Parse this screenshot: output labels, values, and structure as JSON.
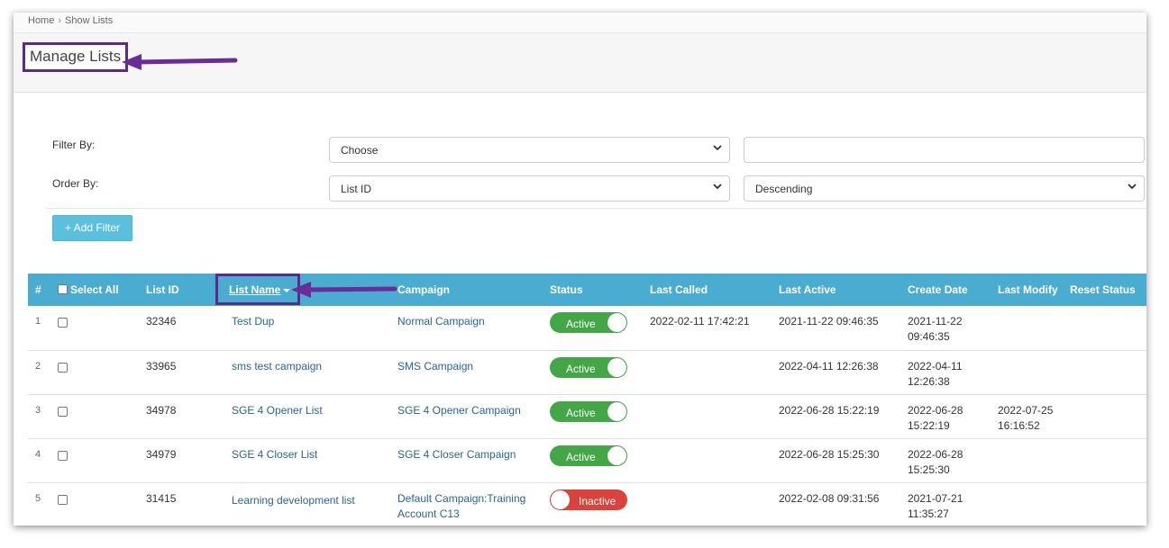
{
  "breadcrumb": {
    "home": "Home",
    "separator": "›",
    "current": "Show Lists"
  },
  "page": {
    "title": "Manage Lists"
  },
  "filters": {
    "filter_by_label": "Filter By:",
    "filter_by_value": "Choose",
    "filter_text_value": "",
    "order_by_label": "Order By:",
    "order_by_value": "List ID",
    "order_direction_value": "Descending",
    "add_filter_label": "+ Add Filter"
  },
  "table": {
    "headers": {
      "num": "#",
      "select_all": "Select All",
      "list_id": "List ID",
      "list_name": "List Name",
      "campaign": "Campaign",
      "status": "Status",
      "last_called": "Last Called",
      "last_active": "Last Active",
      "create_date": "Create Date",
      "last_modify": "Last Modify",
      "reset_status": "Reset Status"
    },
    "rows": [
      {
        "num": "1",
        "list_id": "32346",
        "list_name": "Test Dup",
        "campaign": "Normal Campaign",
        "status": "Active",
        "last_called": "2022-02-11 17:42:21",
        "last_active": "2021-11-22 09:46:35",
        "create_date_1": "2021-11-22",
        "create_date_2": "09:46:35",
        "last_modify_1": "",
        "last_modify_2": ""
      },
      {
        "num": "2",
        "list_id": "33965",
        "list_name": "sms test campaign",
        "campaign": "SMS Campaign",
        "status": "Active",
        "last_called": "",
        "last_active": "2022-04-11 12:26:38",
        "create_date_1": "2022-04-11",
        "create_date_2": "12:26:38",
        "last_modify_1": "",
        "last_modify_2": ""
      },
      {
        "num": "3",
        "list_id": "34978",
        "list_name": "SGE 4 Opener List",
        "campaign": "SGE 4 Opener Campaign",
        "status": "Active",
        "last_called": "",
        "last_active": "2022-06-28 15:22:19",
        "create_date_1": "2022-06-28",
        "create_date_2": "15:22:19",
        "last_modify_1": "2022-07-25",
        "last_modify_2": "16:16:52"
      },
      {
        "num": "4",
        "list_id": "34979",
        "list_name": "SGE 4 Closer List",
        "campaign": "SGE 4 Closer Campaign",
        "status": "Active",
        "last_called": "",
        "last_active": "2022-06-28 15:25:30",
        "create_date_1": "2022-06-28",
        "create_date_2": "15:25:30",
        "last_modify_1": "",
        "last_modify_2": ""
      },
      {
        "num": "5",
        "list_id": "31415",
        "list_name": "Learning development list",
        "campaign_1": "Default Campaign:Training",
        "campaign_2": "Account C13",
        "status": "Inactive",
        "last_called": "",
        "last_active": "2022-02-08 09:31:56",
        "create_date_1": "2021-07-21",
        "create_date_2": "11:35:27",
        "last_modify_1": "",
        "last_modify_2": ""
      }
    ]
  },
  "colors": {
    "header_bg": "#4bacd1",
    "highlight_border": "#5b2a8c",
    "active_toggle": "#43a747",
    "inactive_toggle": "#d9433b",
    "link": "#2a6496",
    "add_filter_bg": "#5bc0de"
  }
}
